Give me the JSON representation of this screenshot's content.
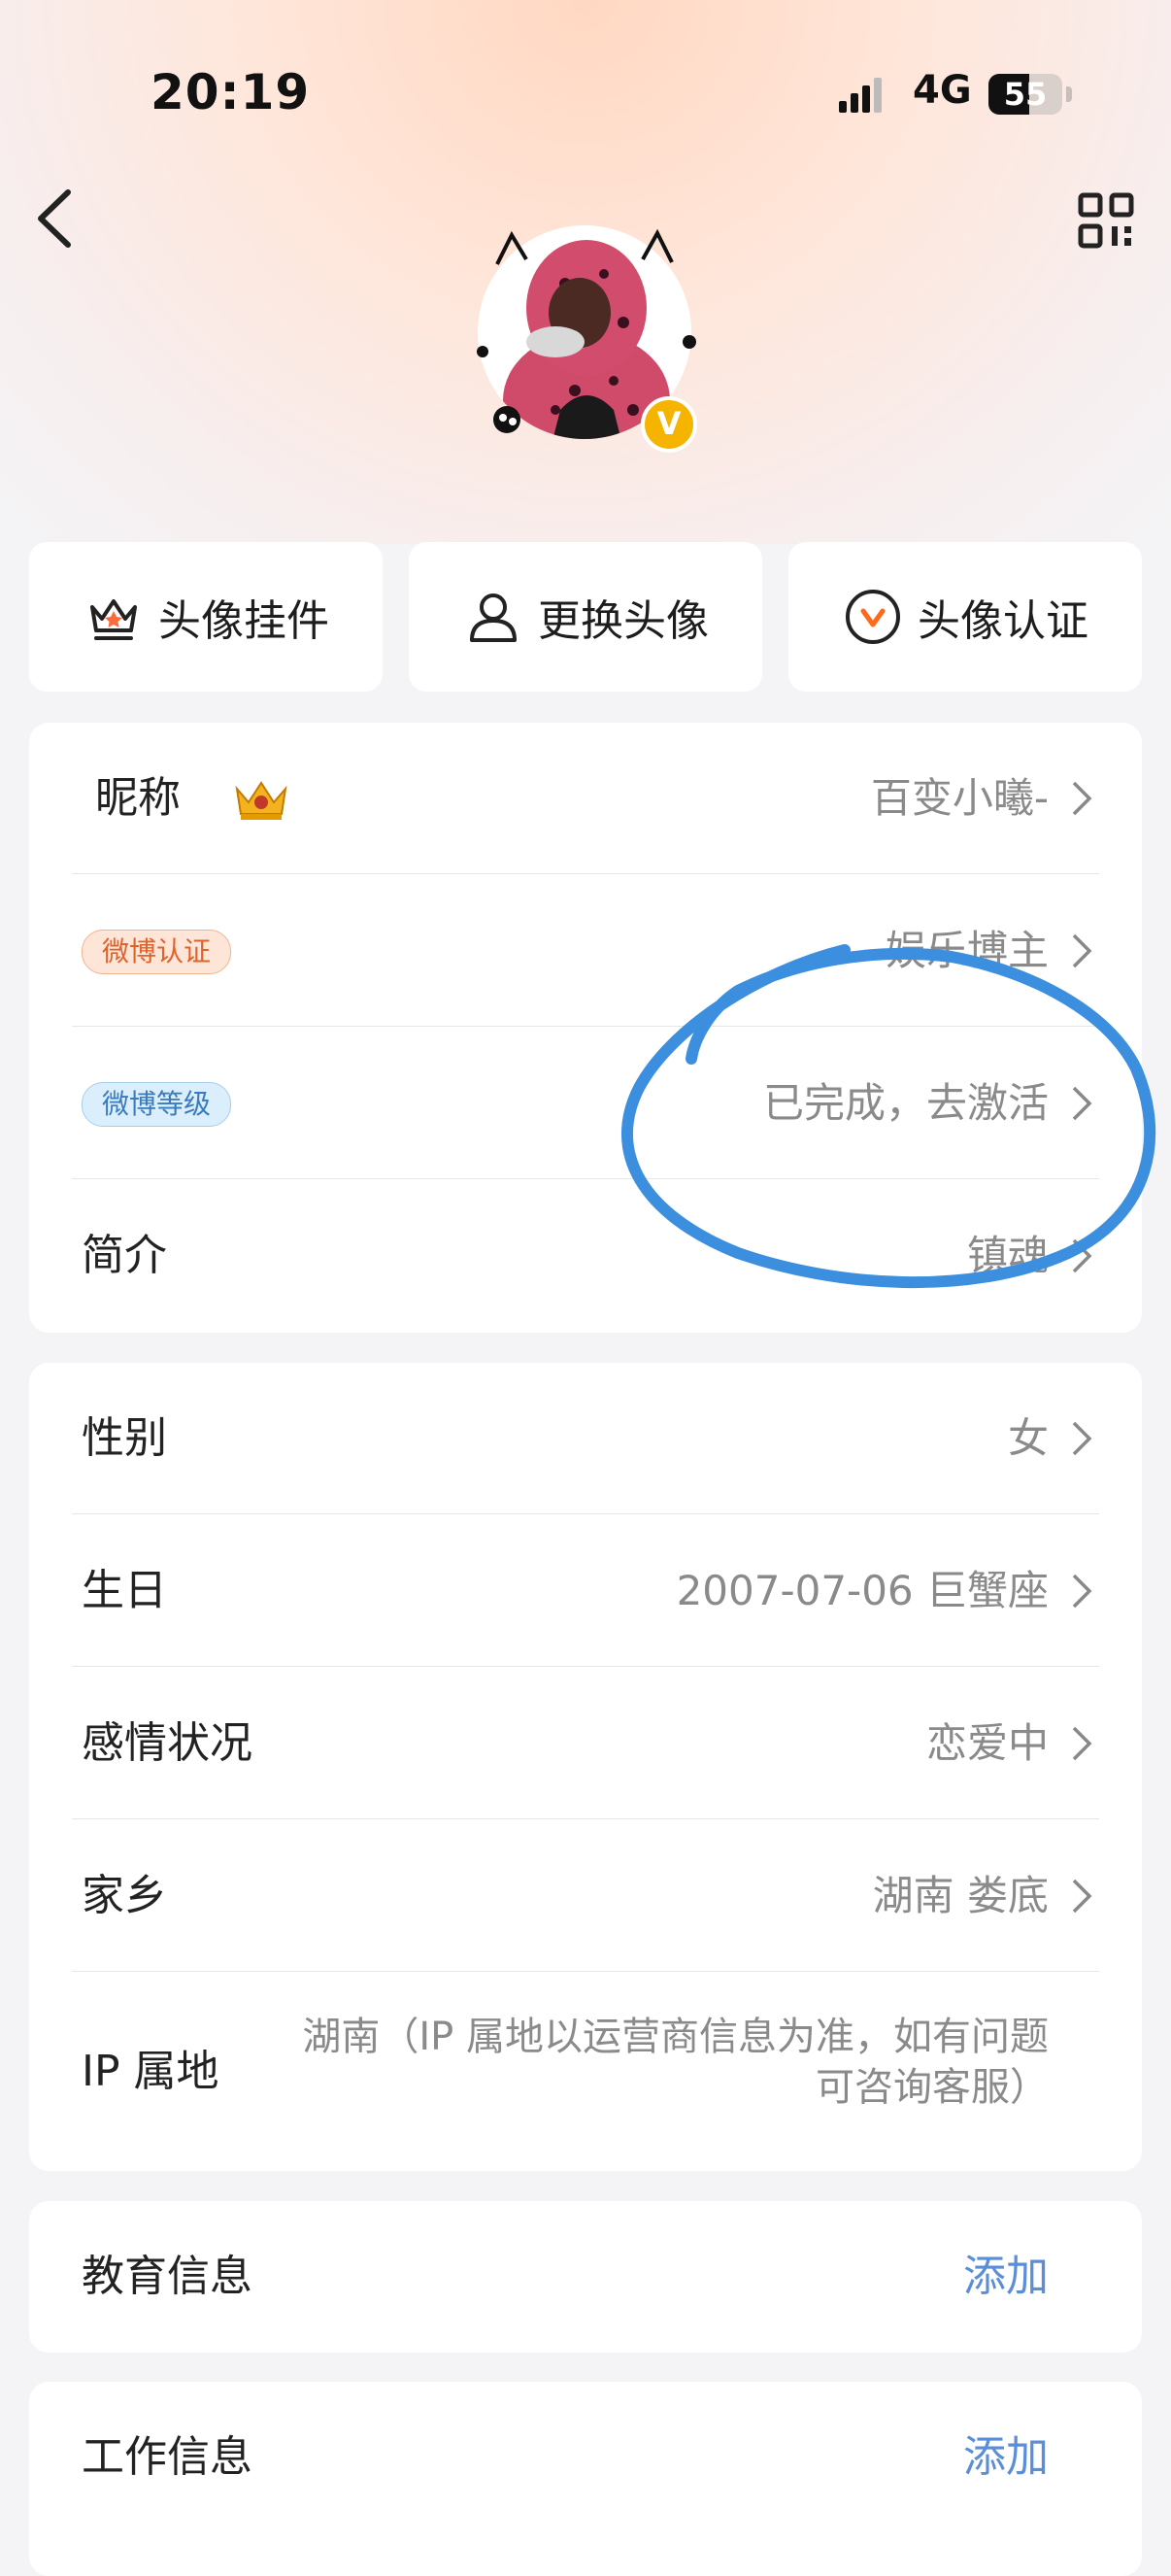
{
  "status_bar": {
    "time": "20:19",
    "network": "4G",
    "battery": "55",
    "battery_level": 0.55
  },
  "header": {
    "back_icon": "chevron-left-icon",
    "qr_icon": "qr-code-icon",
    "verify_badge": "V"
  },
  "actions": [
    {
      "label": "头像挂件",
      "icon": "crown-pendant-icon"
    },
    {
      "label": "更换头像",
      "icon": "person-icon"
    },
    {
      "label": "头像认证",
      "icon": "verify-v-icon"
    }
  ],
  "profile": {
    "nickname_label": "昵称",
    "nickname_value": "百变小曦-",
    "weibo_verify_tag": "微博认证",
    "weibo_verify_value": "娱乐博主",
    "weibo_level_tag": "微博等级",
    "weibo_level_value": "已完成，去激活",
    "bio_label": "简介",
    "bio_value": "镇魂"
  },
  "details": {
    "gender_label": "性别",
    "gender_value": "女",
    "birthday_label": "生日",
    "birthday_value": "2007-07-06 巨蟹座",
    "relationship_label": "感情状况",
    "relationship_value": "恋爱中",
    "hometown_label": "家乡",
    "hometown_value": "湖南 娄底",
    "ip_label": "IP 属地",
    "ip_value": "湖南（IP 属地以运营商信息为准，如有问题可咨询客服）"
  },
  "education": {
    "label": "教育信息",
    "action": "添加"
  },
  "work": {
    "label": "工作信息",
    "action": "添加"
  },
  "colors": {
    "link": "#5b8ed8",
    "annotation": "#3b8fde",
    "tag_orange": "#e0622b",
    "tag_blue": "#3a7bc0"
  }
}
